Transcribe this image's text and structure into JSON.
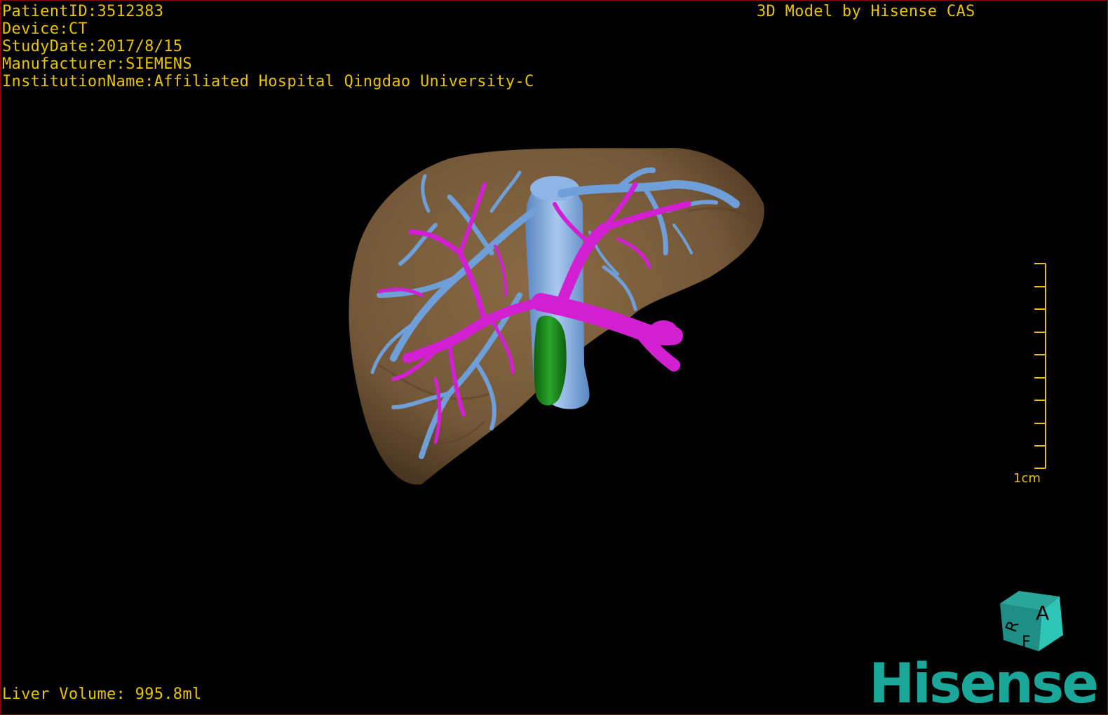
{
  "study_info": {
    "patient_id": "PatientID:3512383",
    "device": "Device:CT",
    "study_date": "StudyDate:2017/8/15",
    "manufacturer": "Manufacturer:SIEMENS",
    "institution": "InstitutionName:Affiliated Hospital Qingdao University-C"
  },
  "credit": "3D Model by Hisense CAS",
  "liver_volume": "Liver Volume: 995.8ml",
  "scale_bar": {
    "label": "1cm"
  },
  "orientation_cube": {
    "face_top": "A",
    "face_bottom": "F",
    "face_left": "R"
  },
  "brand": "Hisense",
  "colors": {
    "overlay_text": "#e8c400",
    "liver": "#7a5c3a",
    "hepatic_vein": "#6f9fd8",
    "portal_vein": "#d21fd2",
    "gallbladder": "#1d8a1d",
    "brand": "#1aa79a"
  }
}
